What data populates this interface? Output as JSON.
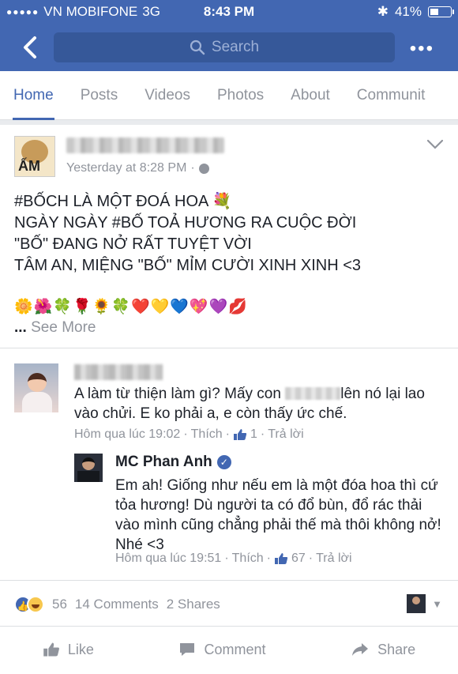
{
  "status_bar": {
    "carrier": "VN MOBIFONE",
    "network": "3G",
    "time": "8:43 PM",
    "battery": "41%",
    "battery_level": 0.41
  },
  "nav": {
    "search_placeholder": "Search",
    "more": "•••"
  },
  "tabs": [
    {
      "label": "Home",
      "active": true
    },
    {
      "label": "Posts"
    },
    {
      "label": "Videos"
    },
    {
      "label": "Photos"
    },
    {
      "label": "About"
    },
    {
      "label": "Communit"
    }
  ],
  "post": {
    "avatar_label": "ẤM",
    "time": "Yesterday at 8:28 PM",
    "time_sep": "·",
    "lines": [
      "#BỐCH LÀ MỘT ĐOÁ HOA 💐",
      "NGÀY NGÀY #BỐ TOẢ HƯƠNG RA CUỘC ĐỜI",
      "\"BỐ\" ĐANG NỞ RẤT TUYỆT VỜI",
      "TÂM AN, MIỆNG \"BỐ\" MỈM CƯỜI XINH XINH <3"
    ],
    "emojis": "🌼🌺🍀🌹🌻🍀❤️💛💙💖💜💋",
    "see_more_dots": "...",
    "see_more": "See More"
  },
  "comments": [
    {
      "text_before": "A làm từ thiện làm gì? Mấy con",
      "text_after": "lên nó lại lao vào chửi. E ko phải a, e còn thấy ức chế.",
      "time": "Hôm qua lúc 19:02",
      "reply": "Thích",
      "likes": "1",
      "reply_action": "Trả lời"
    },
    {
      "name": "MC Phan Anh",
      "text": "Em ah! Giống như nếu em là một đóa hoa thì cứ tỏa hương! Dù người ta có đổ bùn, đổ rác thải vào mình cũng chẳng phải thế mà thôi không nở! Nhé <3",
      "time": "Hôm qua lúc 19:51",
      "reply": "Thích",
      "likes": "67",
      "reply_action": "Trả lời"
    }
  ],
  "summary": {
    "reactions": "56",
    "comments": "14 Comments",
    "shares": "2 Shares"
  },
  "actions": {
    "like": "Like",
    "comment": "Comment",
    "share": "Share"
  }
}
